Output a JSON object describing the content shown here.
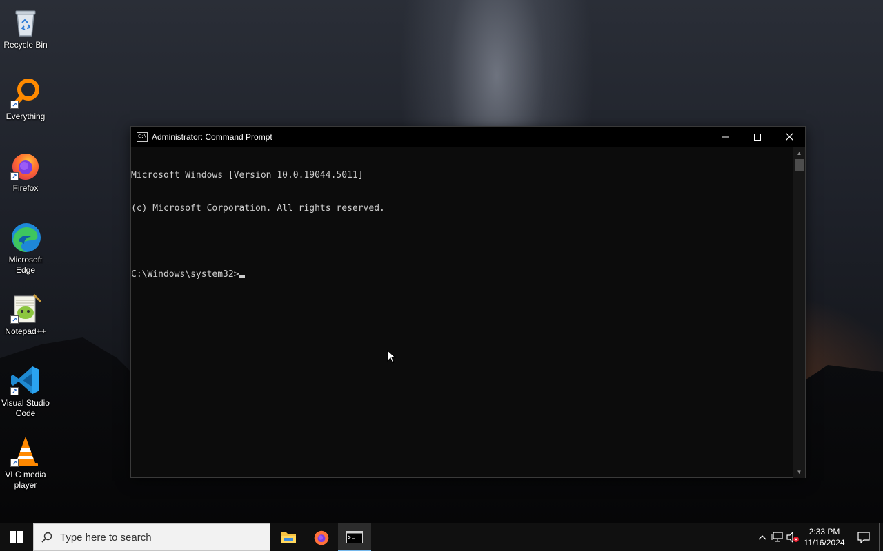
{
  "desktop": {
    "icons": [
      {
        "label": "Recycle Bin",
        "icon": "recycle-bin-icon"
      },
      {
        "label": "Everything",
        "icon": "everything-search-icon"
      },
      {
        "label": "Firefox",
        "icon": "firefox-icon"
      },
      {
        "label": "Microsoft Edge",
        "icon": "edge-icon"
      },
      {
        "label": "Notepad++",
        "icon": "notepad-plus-plus-icon"
      },
      {
        "label": "Visual Studio Code",
        "icon": "vscode-icon"
      },
      {
        "label": "VLC media player",
        "icon": "vlc-icon"
      }
    ]
  },
  "cmd": {
    "title": "Administrator: Command Prompt",
    "title_icon_text": "C:\\",
    "lines": [
      "Microsoft Windows [Version 10.0.19044.5011]",
      "(c) Microsoft Corporation. All rights reserved.",
      "",
      "C:\\Windows\\system32>"
    ],
    "colors": {
      "background": "#0c0c0c",
      "text": "#cccccc"
    }
  },
  "taskbar": {
    "search_placeholder": "Type here to search",
    "apps": [
      {
        "name": "File Explorer",
        "icon": "file-explorer-icon",
        "active": false
      },
      {
        "name": "Firefox",
        "icon": "firefox-icon",
        "active": false
      },
      {
        "name": "Command Prompt",
        "icon": "cmd-icon",
        "active": true
      }
    ],
    "clock": {
      "time": "2:33 PM",
      "date": "11/16/2024"
    },
    "accent": "#76b9ed"
  }
}
